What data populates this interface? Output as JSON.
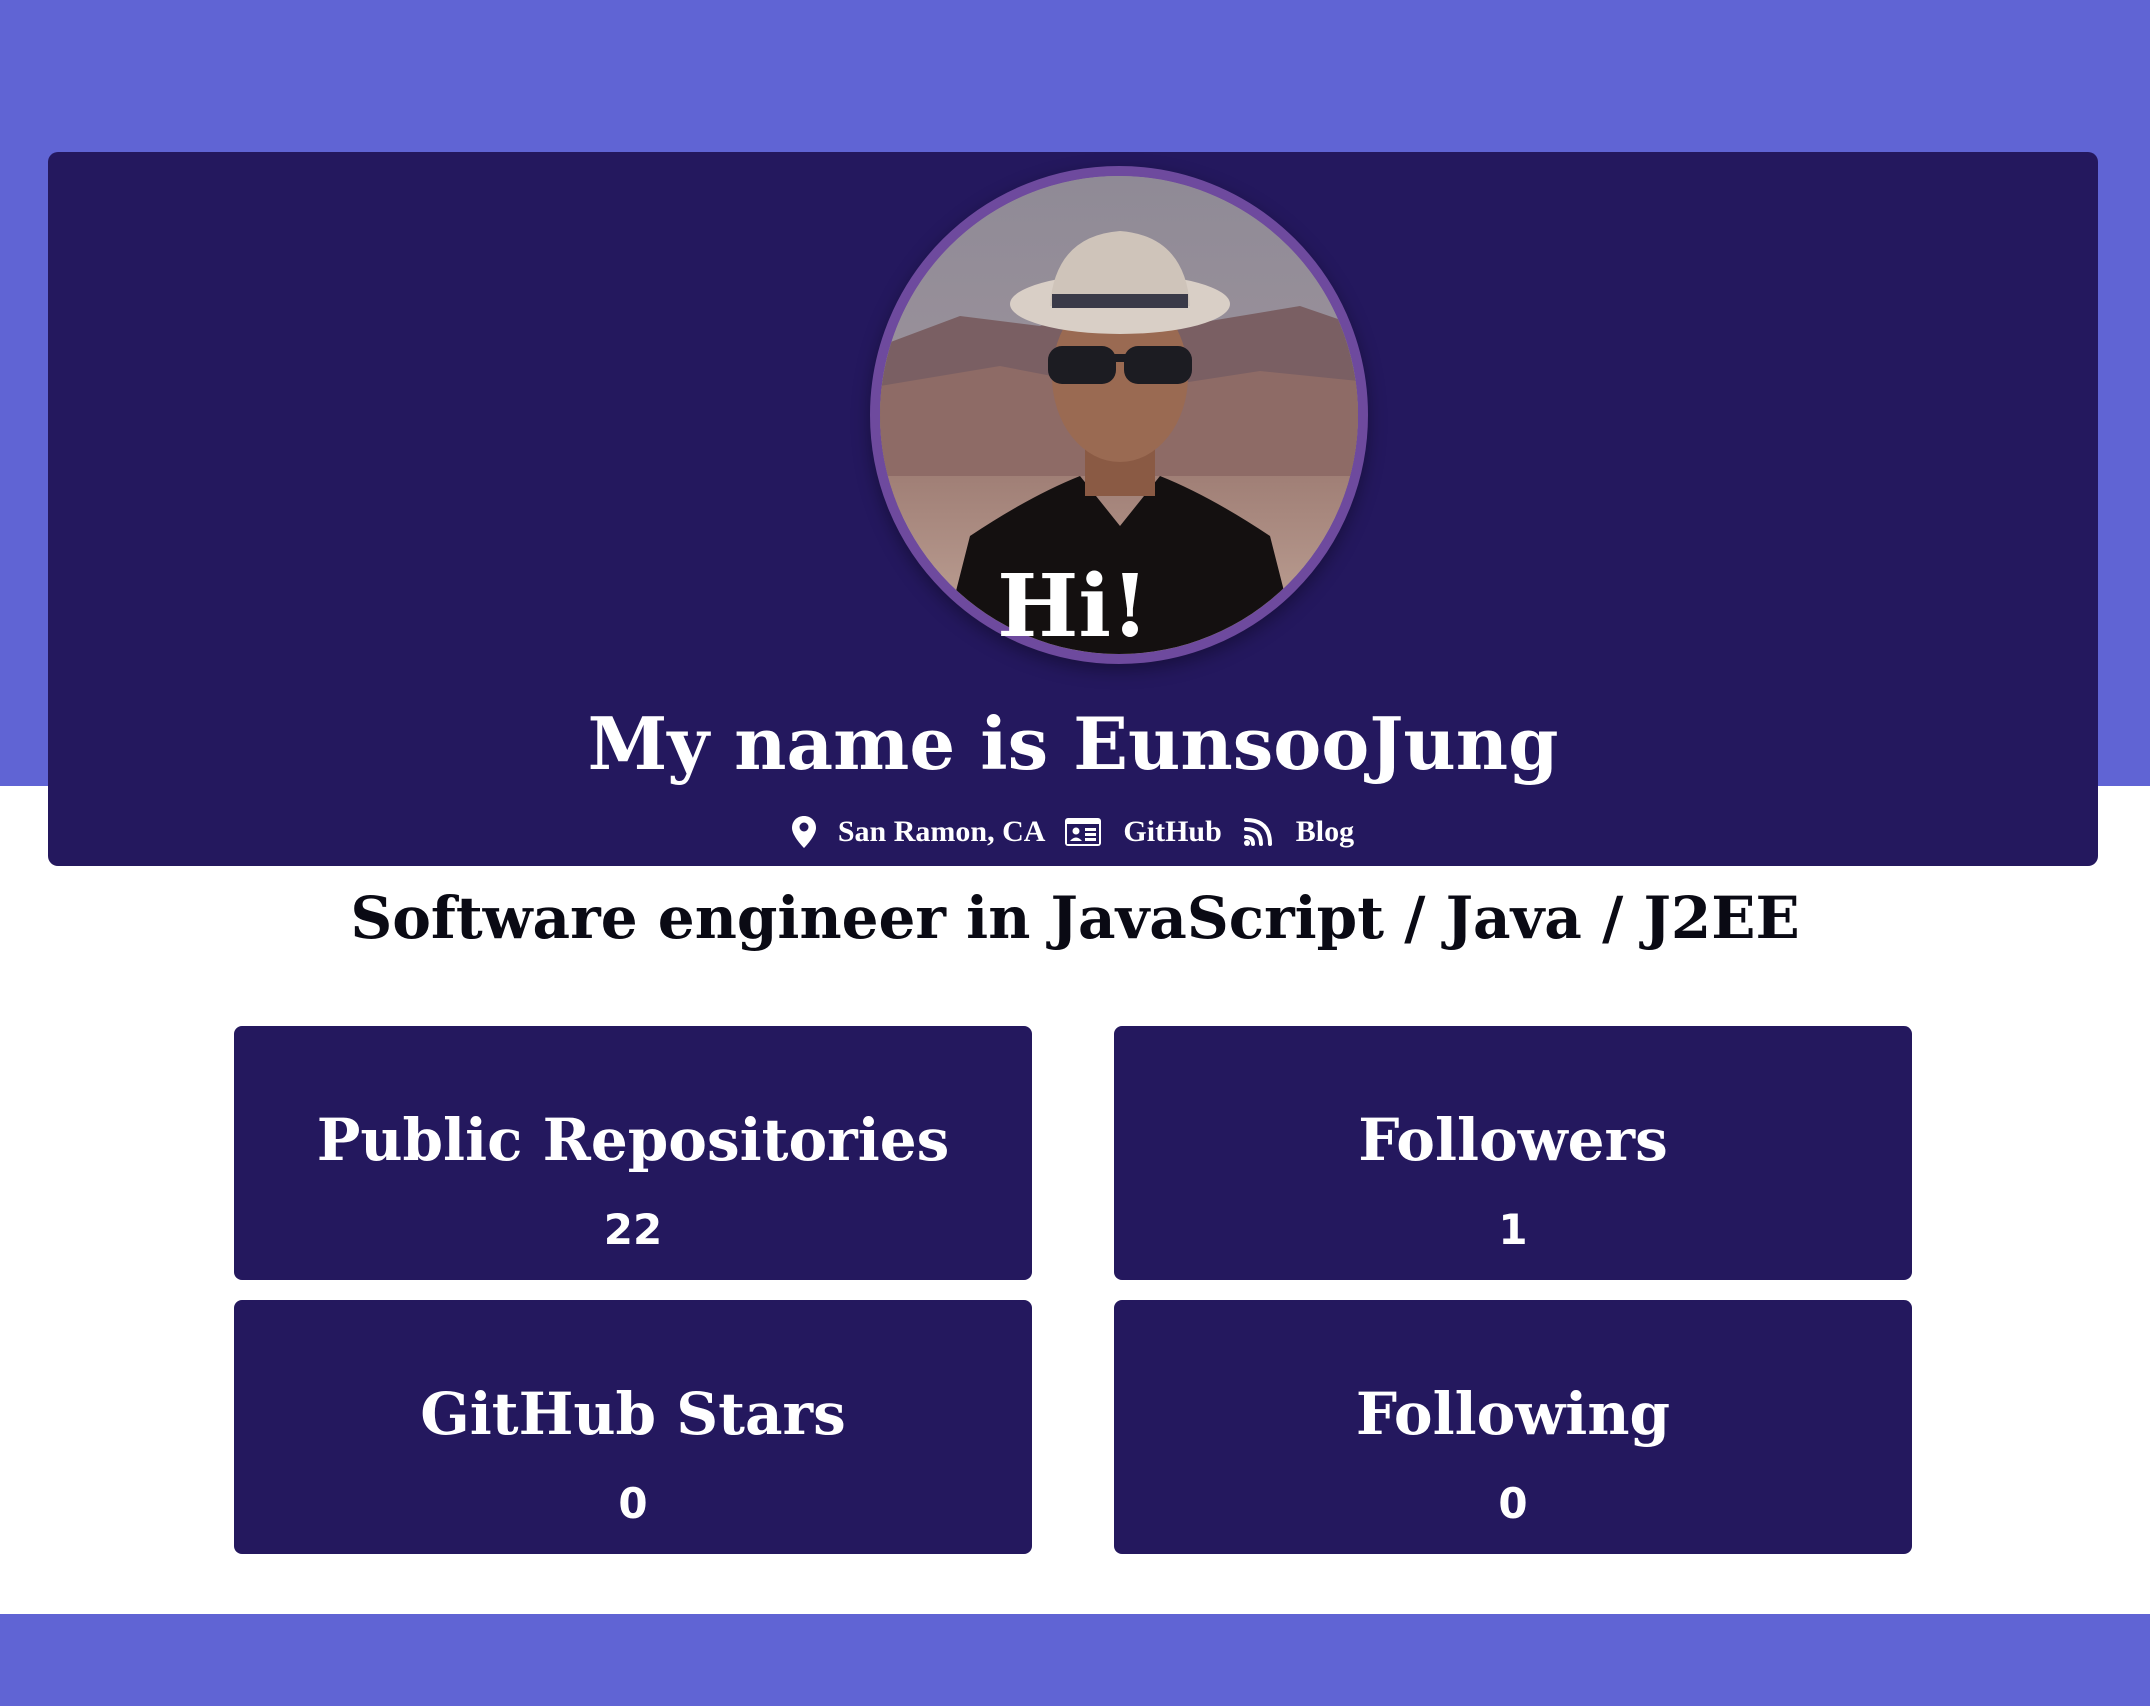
{
  "hero": {
    "greeting": "Hi!",
    "name_line": "My name is EunsooJung",
    "avatar_icon": "profile-photo"
  },
  "links": {
    "location": {
      "label": "San Ramon, CA",
      "icon": "map-pin-icon"
    },
    "github": {
      "label": "GitHub",
      "icon": "id-card-icon"
    },
    "blog": {
      "label": "Blog",
      "icon": "rss-feed-icon"
    }
  },
  "tagline": "Software engineer in JavaScript / Java / J2EE",
  "stats": [
    {
      "label": "Public Repositories",
      "value": "22"
    },
    {
      "label": "Followers",
      "value": "1"
    },
    {
      "label": "GitHub Stars",
      "value": "0"
    },
    {
      "label": "Following",
      "value": "0"
    }
  ],
  "colors": {
    "band": "#6064d4",
    "card": "#24185e",
    "avatar_ring": "#6e4a9e",
    "text_on_card": "#ffffff",
    "tagline_text": "#0a0a14"
  }
}
